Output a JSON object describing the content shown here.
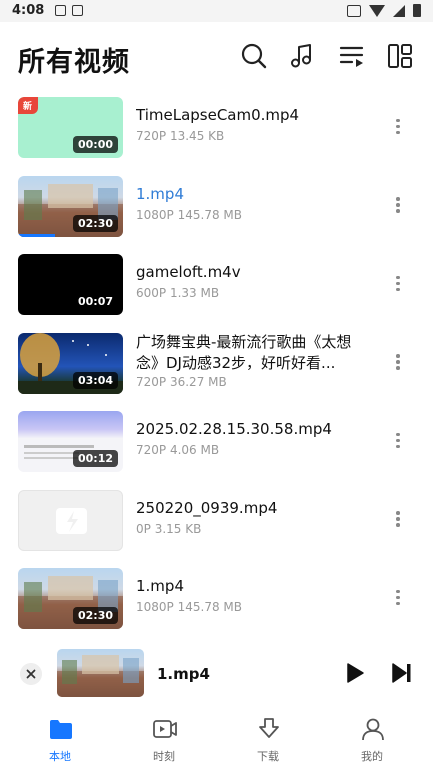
{
  "status_bar": {
    "time": "4:08"
  },
  "header": {
    "title": "所有视频"
  },
  "colors": {
    "accent": "#1677ff",
    "active_title": "#2f7cd6",
    "new_badge": "#e8463a"
  },
  "videos": [
    {
      "title": "TimeLapseCam0.mp4",
      "resolution": "720P",
      "size": "13.45 KB",
      "duration": "00:00",
      "badge": "新",
      "thumbnail": "mint"
    },
    {
      "title": "1.mp4",
      "resolution": "1080P",
      "size": "145.78 MB",
      "duration": "02:30",
      "active": true,
      "progress": 0.35,
      "thumbnail": "room"
    },
    {
      "title": "gameloft.m4v",
      "resolution": "600P",
      "size": "1.33 MB",
      "duration": "00:07",
      "thumbnail": "black"
    },
    {
      "title": "广场舞宝典-最新流行歌曲《太想念》DJ动感32步，好听好看...",
      "resolution": "720P",
      "size": "36.27 MB",
      "duration": "03:04",
      "thumbnail": "night-sky"
    },
    {
      "title": "2025.02.28.15.30.58.mp4",
      "resolution": "720P",
      "size": "4.06 MB",
      "duration": "00:12",
      "thumbnail": "screen-record"
    },
    {
      "title": "250220_0939.mp4",
      "resolution": "0P",
      "size": "3.15 KB",
      "duration": "",
      "thumbnail": "broken"
    },
    {
      "title": "1.mp4",
      "resolution": "1080P",
      "size": "145.78 MB",
      "duration": "02:30",
      "thumbnail": "room"
    }
  ],
  "player": {
    "title": "1.mp4"
  },
  "nav": [
    {
      "label": "本地",
      "icon": "folder-icon",
      "active": true
    },
    {
      "label": "时刻",
      "icon": "video-moments-icon"
    },
    {
      "label": "下载",
      "icon": "download-icon"
    },
    {
      "label": "我的",
      "icon": "profile-icon"
    }
  ]
}
